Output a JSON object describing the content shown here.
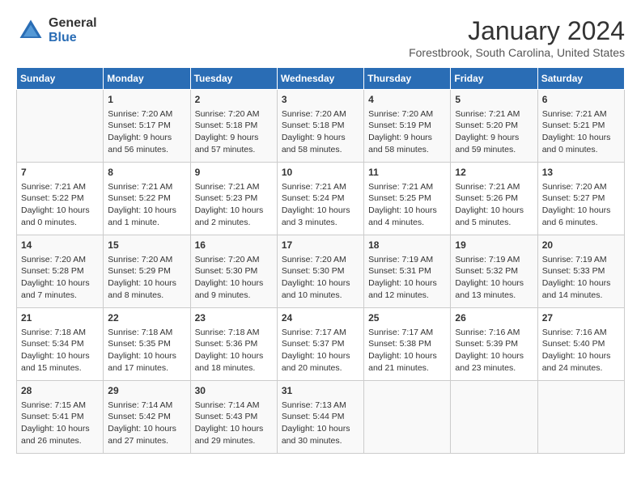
{
  "header": {
    "logo": {
      "general": "General",
      "blue": "Blue"
    },
    "title": "January 2024",
    "subtitle": "Forestbrook, South Carolina, United States"
  },
  "days_of_week": [
    "Sunday",
    "Monday",
    "Tuesday",
    "Wednesday",
    "Thursday",
    "Friday",
    "Saturday"
  ],
  "weeks": [
    [
      {
        "day": "",
        "info": ""
      },
      {
        "day": "1",
        "info": "Sunrise: 7:20 AM\nSunset: 5:17 PM\nDaylight: 9 hours\nand 56 minutes."
      },
      {
        "day": "2",
        "info": "Sunrise: 7:20 AM\nSunset: 5:18 PM\nDaylight: 9 hours\nand 57 minutes."
      },
      {
        "day": "3",
        "info": "Sunrise: 7:20 AM\nSunset: 5:18 PM\nDaylight: 9 hours\nand 58 minutes."
      },
      {
        "day": "4",
        "info": "Sunrise: 7:20 AM\nSunset: 5:19 PM\nDaylight: 9 hours\nand 58 minutes."
      },
      {
        "day": "5",
        "info": "Sunrise: 7:21 AM\nSunset: 5:20 PM\nDaylight: 9 hours\nand 59 minutes."
      },
      {
        "day": "6",
        "info": "Sunrise: 7:21 AM\nSunset: 5:21 PM\nDaylight: 10 hours\nand 0 minutes."
      }
    ],
    [
      {
        "day": "7",
        "info": "Sunrise: 7:21 AM\nSunset: 5:22 PM\nDaylight: 10 hours\nand 0 minutes."
      },
      {
        "day": "8",
        "info": "Sunrise: 7:21 AM\nSunset: 5:22 PM\nDaylight: 10 hours\nand 1 minute."
      },
      {
        "day": "9",
        "info": "Sunrise: 7:21 AM\nSunset: 5:23 PM\nDaylight: 10 hours\nand 2 minutes."
      },
      {
        "day": "10",
        "info": "Sunrise: 7:21 AM\nSunset: 5:24 PM\nDaylight: 10 hours\nand 3 minutes."
      },
      {
        "day": "11",
        "info": "Sunrise: 7:21 AM\nSunset: 5:25 PM\nDaylight: 10 hours\nand 4 minutes."
      },
      {
        "day": "12",
        "info": "Sunrise: 7:21 AM\nSunset: 5:26 PM\nDaylight: 10 hours\nand 5 minutes."
      },
      {
        "day": "13",
        "info": "Sunrise: 7:20 AM\nSunset: 5:27 PM\nDaylight: 10 hours\nand 6 minutes."
      }
    ],
    [
      {
        "day": "14",
        "info": "Sunrise: 7:20 AM\nSunset: 5:28 PM\nDaylight: 10 hours\nand 7 minutes."
      },
      {
        "day": "15",
        "info": "Sunrise: 7:20 AM\nSunset: 5:29 PM\nDaylight: 10 hours\nand 8 minutes."
      },
      {
        "day": "16",
        "info": "Sunrise: 7:20 AM\nSunset: 5:30 PM\nDaylight: 10 hours\nand 9 minutes."
      },
      {
        "day": "17",
        "info": "Sunrise: 7:20 AM\nSunset: 5:30 PM\nDaylight: 10 hours\nand 10 minutes."
      },
      {
        "day": "18",
        "info": "Sunrise: 7:19 AM\nSunset: 5:31 PM\nDaylight: 10 hours\nand 12 minutes."
      },
      {
        "day": "19",
        "info": "Sunrise: 7:19 AM\nSunset: 5:32 PM\nDaylight: 10 hours\nand 13 minutes."
      },
      {
        "day": "20",
        "info": "Sunrise: 7:19 AM\nSunset: 5:33 PM\nDaylight: 10 hours\nand 14 minutes."
      }
    ],
    [
      {
        "day": "21",
        "info": "Sunrise: 7:18 AM\nSunset: 5:34 PM\nDaylight: 10 hours\nand 15 minutes."
      },
      {
        "day": "22",
        "info": "Sunrise: 7:18 AM\nSunset: 5:35 PM\nDaylight: 10 hours\nand 17 minutes."
      },
      {
        "day": "23",
        "info": "Sunrise: 7:18 AM\nSunset: 5:36 PM\nDaylight: 10 hours\nand 18 minutes."
      },
      {
        "day": "24",
        "info": "Sunrise: 7:17 AM\nSunset: 5:37 PM\nDaylight: 10 hours\nand 20 minutes."
      },
      {
        "day": "25",
        "info": "Sunrise: 7:17 AM\nSunset: 5:38 PM\nDaylight: 10 hours\nand 21 minutes."
      },
      {
        "day": "26",
        "info": "Sunrise: 7:16 AM\nSunset: 5:39 PM\nDaylight: 10 hours\nand 23 minutes."
      },
      {
        "day": "27",
        "info": "Sunrise: 7:16 AM\nSunset: 5:40 PM\nDaylight: 10 hours\nand 24 minutes."
      }
    ],
    [
      {
        "day": "28",
        "info": "Sunrise: 7:15 AM\nSunset: 5:41 PM\nDaylight: 10 hours\nand 26 minutes."
      },
      {
        "day": "29",
        "info": "Sunrise: 7:14 AM\nSunset: 5:42 PM\nDaylight: 10 hours\nand 27 minutes."
      },
      {
        "day": "30",
        "info": "Sunrise: 7:14 AM\nSunset: 5:43 PM\nDaylight: 10 hours\nand 29 minutes."
      },
      {
        "day": "31",
        "info": "Sunrise: 7:13 AM\nSunset: 5:44 PM\nDaylight: 10 hours\nand 30 minutes."
      },
      {
        "day": "",
        "info": ""
      },
      {
        "day": "",
        "info": ""
      },
      {
        "day": "",
        "info": ""
      }
    ]
  ]
}
